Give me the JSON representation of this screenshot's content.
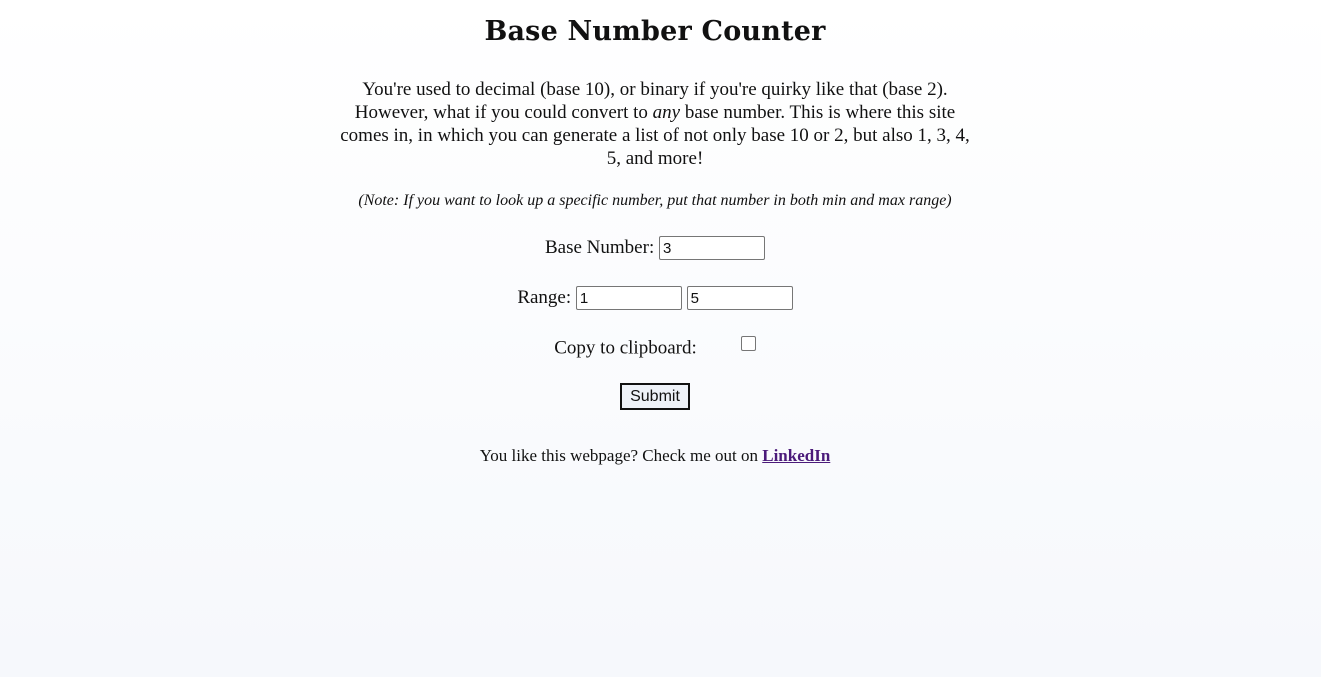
{
  "header": {
    "title": "Base Number Counter"
  },
  "intro": {
    "part1": "You're used to decimal (base 10), or binary if you're quirky like that (base 2). However, what if you could convert to ",
    "emphasis": "any",
    "part2": " base number. This is where this site comes in, in which you can generate a list of not only base 10 or 2, but also 1, 3, 4, 5, and more!"
  },
  "note": "(Note: If you want to look up a specific number, put that number in both min and max range)",
  "form": {
    "base_label": "Base Number:",
    "base_value": "3",
    "range_label": "Range:",
    "range_min_value": "1",
    "range_max_value": "5",
    "copy_label": "Copy to clipboard:",
    "copy_checked": false,
    "submit_label": "Submit"
  },
  "footer": {
    "text": "You like this webpage? Check me out on ",
    "link_label": "LinkedIn"
  }
}
